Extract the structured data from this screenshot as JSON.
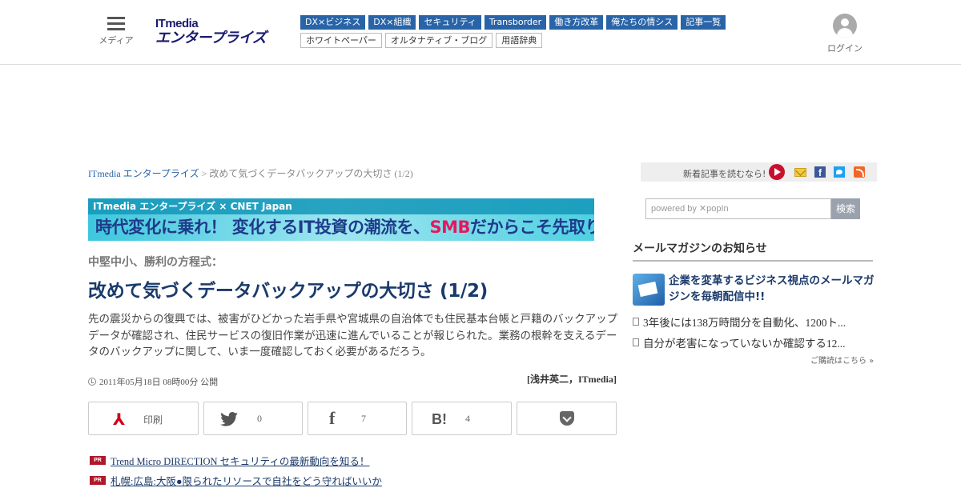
{
  "header": {
    "menu_label": "メディア",
    "logo_top": "ITmedia",
    "logo_bottom": "エンタープライズ",
    "nav_primary": [
      "DX×ビジネス",
      "DX×組織",
      "セキュリティ",
      "Transborder",
      "働き方改革",
      "俺たちの情シス",
      "記事一覧"
    ],
    "nav_secondary": [
      "ホワイトペーパー",
      "オルタナティブ・ブログ",
      "用語辞典"
    ],
    "login_label": "ログイン"
  },
  "breadcrumb": {
    "home": "ITmedia エンタープライズ",
    "separator": " > ",
    "current": "改めて気づくデータバックアップの大切さ (1/2)"
  },
  "news_bar": {
    "label": "新着記事を読むなら!"
  },
  "banner": {
    "top": "ITmedia エンタープライズ × CNET Japan",
    "main_before": "時代変化に乗れ！ 変化するIT投資の潮流を、",
    "main_highlight": "SMB",
    "main_after": "だからこそ先取りする！"
  },
  "article": {
    "kicker": "中堅中小、勝利の方程式：",
    "title": "改めて気づくデータバックアップの大切さ (1/2)",
    "lead": "先の震災からの復興では、被害がひどかった岩手県や宮城県の自治体でも住民基本台帳と戸籍のバックアップデータが確認され、住民サービスの復旧作業が迅速に進んでいることが報じられた。業務の根幹を支えるデータのバックアップに関して、いま一度確認しておく必要があるだろう。",
    "date": "2011年05月18日 08時00分 公開",
    "author": "[浅井英二，ITmedia]"
  },
  "share": {
    "print_label": "印刷",
    "twitter_count": "0",
    "facebook_count": "7",
    "hatena_icon": "B!",
    "hatena_count": "4"
  },
  "pr": {
    "badge": "PR",
    "items": [
      "Trend Micro DIRECTION セキュリティの最新動向を知る！",
      "札幌:広島:大阪●限られたリソースで自社をどう守ればいいか"
    ]
  },
  "sidebar": {
    "search_placeholder": "powered by ✕popIn",
    "search_button": "検索",
    "mailmag_heading": "メールマガジンのお知らせ",
    "mailmag_promo": "企業を変革するビジネス視点のメールマガジンを毎朝配信中!!",
    "mailmag_items": [
      "3年後には138万時間分を自動化、1200ト...",
      "自分が老害になっていないか確認する12..."
    ],
    "mailmag_more": "ご購読はこちら »"
  },
  "colors": {
    "brand_blue": "#2964a8",
    "title_navy": "#1a3a6b",
    "accent_red": "#c8102e"
  }
}
